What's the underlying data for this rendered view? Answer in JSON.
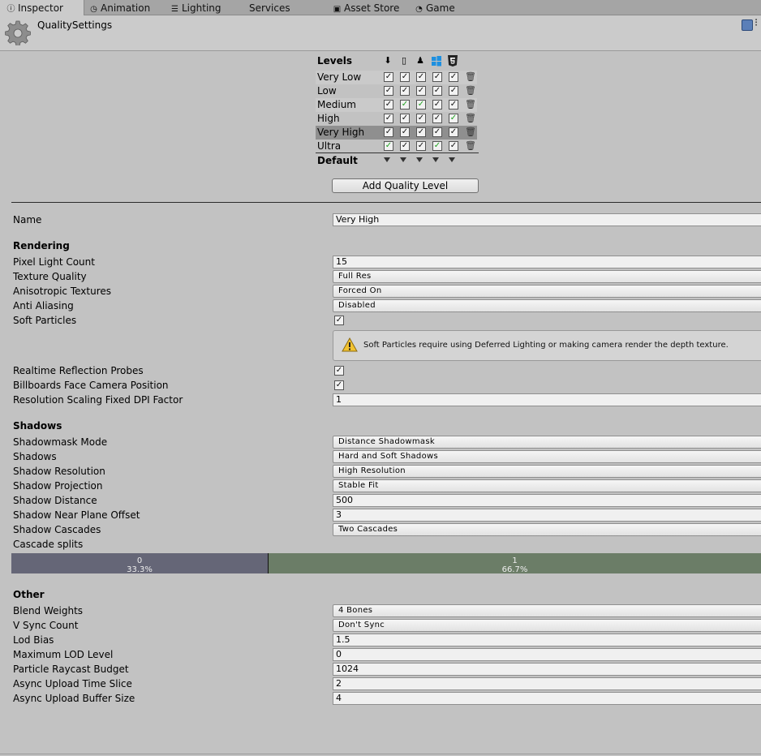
{
  "tabs": [
    {
      "label": "Inspector",
      "icon": "info-icon",
      "active": true
    },
    {
      "label": "Animation",
      "icon": "clock-icon",
      "active": false
    },
    {
      "label": "Lighting",
      "icon": "sliders-icon",
      "active": false
    },
    {
      "label": "Services",
      "icon": "",
      "active": false
    },
    {
      "label": "Asset Store",
      "icon": "bag-icon",
      "active": false
    },
    {
      "label": "Game",
      "icon": "pacman-icon",
      "active": false
    }
  ],
  "header": {
    "title": "QualitySettings"
  },
  "levels": {
    "title": "Levels",
    "platforms": [
      "standalone-download-icon",
      "phone-icon",
      "android-icon",
      "windows-icon",
      "html5-icon"
    ],
    "rows": [
      {
        "name": "Very Low",
        "checks": [
          "checked",
          "checked",
          "checked",
          "checked",
          "checked"
        ]
      },
      {
        "name": "Low",
        "checks": [
          "checked",
          "checked",
          "checked",
          "checked",
          "checked"
        ]
      },
      {
        "name": "Medium",
        "checks": [
          "checked",
          "default",
          "default",
          "checked",
          "checked"
        ]
      },
      {
        "name": "High",
        "checks": [
          "checked",
          "checked",
          "checked",
          "checked",
          "default"
        ]
      },
      {
        "name": "Very High",
        "checks": [
          "checked",
          "checked",
          "checked",
          "checked",
          "checked"
        ],
        "selected": true
      },
      {
        "name": "Ultra",
        "checks": [
          "default",
          "checked",
          "checked",
          "default",
          "checked"
        ]
      }
    ],
    "default_label": "Default",
    "add_button": "Add Quality Level"
  },
  "name_field": {
    "label": "Name",
    "value": "Very High"
  },
  "rendering": {
    "title": "Rendering",
    "pixel_light_count": {
      "label": "Pixel Light Count",
      "value": "15"
    },
    "texture_quality": {
      "label": "Texture Quality",
      "value": "Full Res"
    },
    "anisotropic": {
      "label": "Anisotropic Textures",
      "value": "Forced On"
    },
    "anti_aliasing": {
      "label": "Anti Aliasing",
      "value": "Disabled"
    },
    "soft_particles": {
      "label": "Soft Particles",
      "checked": true
    },
    "soft_particles_warning": "Soft Particles require using Deferred Lighting or making camera render the depth texture.",
    "realtime_reflection": {
      "label": "Realtime Reflection Probes",
      "checked": true
    },
    "billboards": {
      "label": "Billboards Face Camera Position",
      "checked": true
    },
    "dpi_factor": {
      "label": "Resolution Scaling Fixed DPI Factor",
      "value": "1"
    }
  },
  "shadows": {
    "title": "Shadows",
    "shadowmask_mode": {
      "label": "Shadowmask Mode",
      "value": "Distance Shadowmask"
    },
    "shadows": {
      "label": "Shadows",
      "value": "Hard and Soft Shadows"
    },
    "resolution": {
      "label": "Shadow Resolution",
      "value": "High Resolution"
    },
    "projection": {
      "label": "Shadow Projection",
      "value": "Stable Fit"
    },
    "distance": {
      "label": "Shadow Distance",
      "value": "500"
    },
    "near_plane": {
      "label": "Shadow Near Plane Offset",
      "value": "3"
    },
    "cascades": {
      "label": "Shadow Cascades",
      "value": "Two Cascades"
    },
    "cascade_splits_label": "Cascade splits",
    "splits": [
      {
        "index": "0",
        "percent": "33.3%",
        "fraction": 0.333,
        "color": "#656677"
      },
      {
        "index": "1",
        "percent": "66.7%",
        "fraction": 0.667,
        "color": "#6b7d67"
      }
    ]
  },
  "other": {
    "title": "Other",
    "blend_weights": {
      "label": "Blend Weights",
      "value": "4 Bones"
    },
    "vsync": {
      "label": "V Sync Count",
      "value": "Don't Sync"
    },
    "lod_bias": {
      "label": "Lod Bias",
      "value": "1.5"
    },
    "max_lod": {
      "label": "Maximum LOD Level",
      "value": "0"
    },
    "raycast_budget": {
      "label": "Particle Raycast Budget",
      "value": "1024"
    },
    "async_slice": {
      "label": "Async Upload Time Slice",
      "value": "2"
    },
    "async_buffer": {
      "label": "Async Upload Buffer Size",
      "value": "4"
    }
  }
}
